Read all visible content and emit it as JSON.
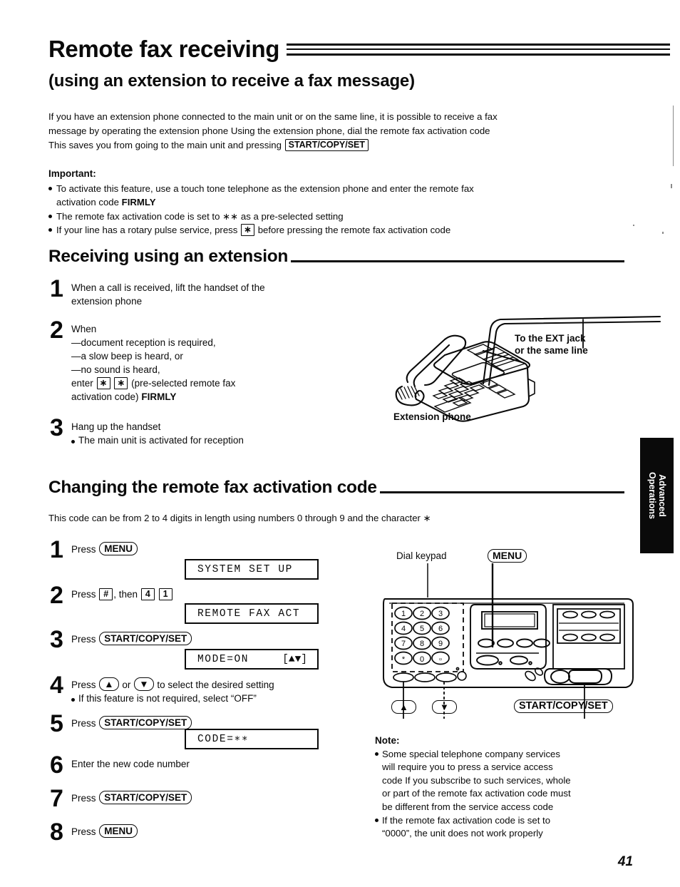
{
  "document": {
    "page_number": "41",
    "side_tab": "Advanced\nOperations",
    "side_tab_line1": "Advanced",
    "side_tab_line2": "Operations"
  },
  "heading": {
    "title": "Remote fax receiving",
    "subtitle": "(using an extension to receive a fax message)"
  },
  "intro": {
    "line1": "If you have an extension phone connected to the main unit or on the same line, it is possible to receive a fax",
    "line2": "message by operating the extension phone  Using the extension phone, dial the remote fax activation code",
    "line3_pre": "This saves you from going to the main unit and pressing",
    "line3_key": "START/COPY/SET"
  },
  "important": {
    "title": "Important:",
    "b1_line1": "To activate this feature, use a touch tone telephone as the extension phone and enter the remote fax",
    "b1_line2_pre": "activation code",
    "b1_line2_bold": "FIRMLY",
    "b2_pre": "The remote fax activation code is set to",
    "b2_code": "∗∗",
    "b2_post": "as a pre-selected setting",
    "b3_pre": "If your line has a rotary pulse service, press",
    "b3_key": "∗",
    "b3_post": "before pressing the remote fax activation code"
  },
  "section_receiving": {
    "title": "Receiving using an extension",
    "steps": [
      {
        "num": "1",
        "line1": "When a call is received, lift the handset of the",
        "line2": "extension phone"
      },
      {
        "num": "2",
        "line1": "When",
        "line2": "—document reception is required,",
        "line3": "—a slow beep is heard, or",
        "line4": "—no sound is heard,",
        "line5_pre": "enter",
        "line5_key1": "∗",
        "line5_key2": "∗",
        "line5_post": "(pre-selected remote fax",
        "line6_pre": "activation code)",
        "line6_bold": "FIRMLY"
      },
      {
        "num": "3",
        "line1": "Hang up the handset",
        "bullet1": "The main unit is activated for reception"
      }
    ]
  },
  "figure_phone": {
    "callout_line1": "To the EXT jack",
    "callout_line2": "or the same line",
    "caption": "Extension phone"
  },
  "section_changing": {
    "title": "Changing the remote fax activation code",
    "intro": "This code can be from 2 to 4 digits in length using numbers 0 through 9 and the character ∗",
    "steps": [
      {
        "num": "1",
        "press_label": "Press",
        "key": "MENU",
        "key_style": "round"
      },
      {
        "num": "2",
        "press_label": "Press",
        "key1": "#",
        "then_label": ", then",
        "key2": "4",
        "key3": "1"
      },
      {
        "num": "3",
        "press_label": "Press",
        "key": "START/COPY/SET",
        "key_style": "round"
      },
      {
        "num": "4",
        "line_pre": "Press",
        "key_up": "▲",
        "or_label": "or",
        "key_down": "▼",
        "line_post": "to select the desired setting",
        "bullet1": "If this feature is not required, select “OFF”"
      },
      {
        "num": "5",
        "press_label": "Press",
        "key": "START/COPY/SET",
        "key_style": "round"
      },
      {
        "num": "6",
        "line1": "Enter the new code number"
      },
      {
        "num": "7",
        "press_label": "Press",
        "key": "START/COPY/SET",
        "key_style": "round"
      },
      {
        "num": "8",
        "press_label": "Press",
        "key": "MENU",
        "key_style": "round"
      }
    ],
    "displays": [
      {
        "text": "SYSTEM SET UP",
        "right": ""
      },
      {
        "text": "REMOTE FAX ACT",
        "right": ""
      },
      {
        "text": "MODE=ON",
        "right": "[▲▼]"
      },
      {
        "text": "CODE=∗∗",
        "right": ""
      }
    ]
  },
  "figure_fax": {
    "label_keypad": "Dial keypad",
    "label_menu": "MENU",
    "label_up": "▲",
    "label_down": "▼",
    "label_start": "START/COPY/SET",
    "keypad_keys": [
      "1",
      "2",
      "3",
      "4",
      "5",
      "6",
      "7",
      "8",
      "9",
      "∗",
      "0",
      "□"
    ]
  },
  "note": {
    "title": "Note:",
    "b1_l1": "Some special telephone company services",
    "b1_l2": "will require you to press a service access",
    "b1_l3": "code  If you subscribe to such services, whole",
    "b1_l4": "or part of the remote fax activation code must",
    "b1_l5": "be different from the service access code",
    "b2_l1": "If the remote fax activation code is set to",
    "b2_l2": "“0000”, the unit does not work properly"
  }
}
